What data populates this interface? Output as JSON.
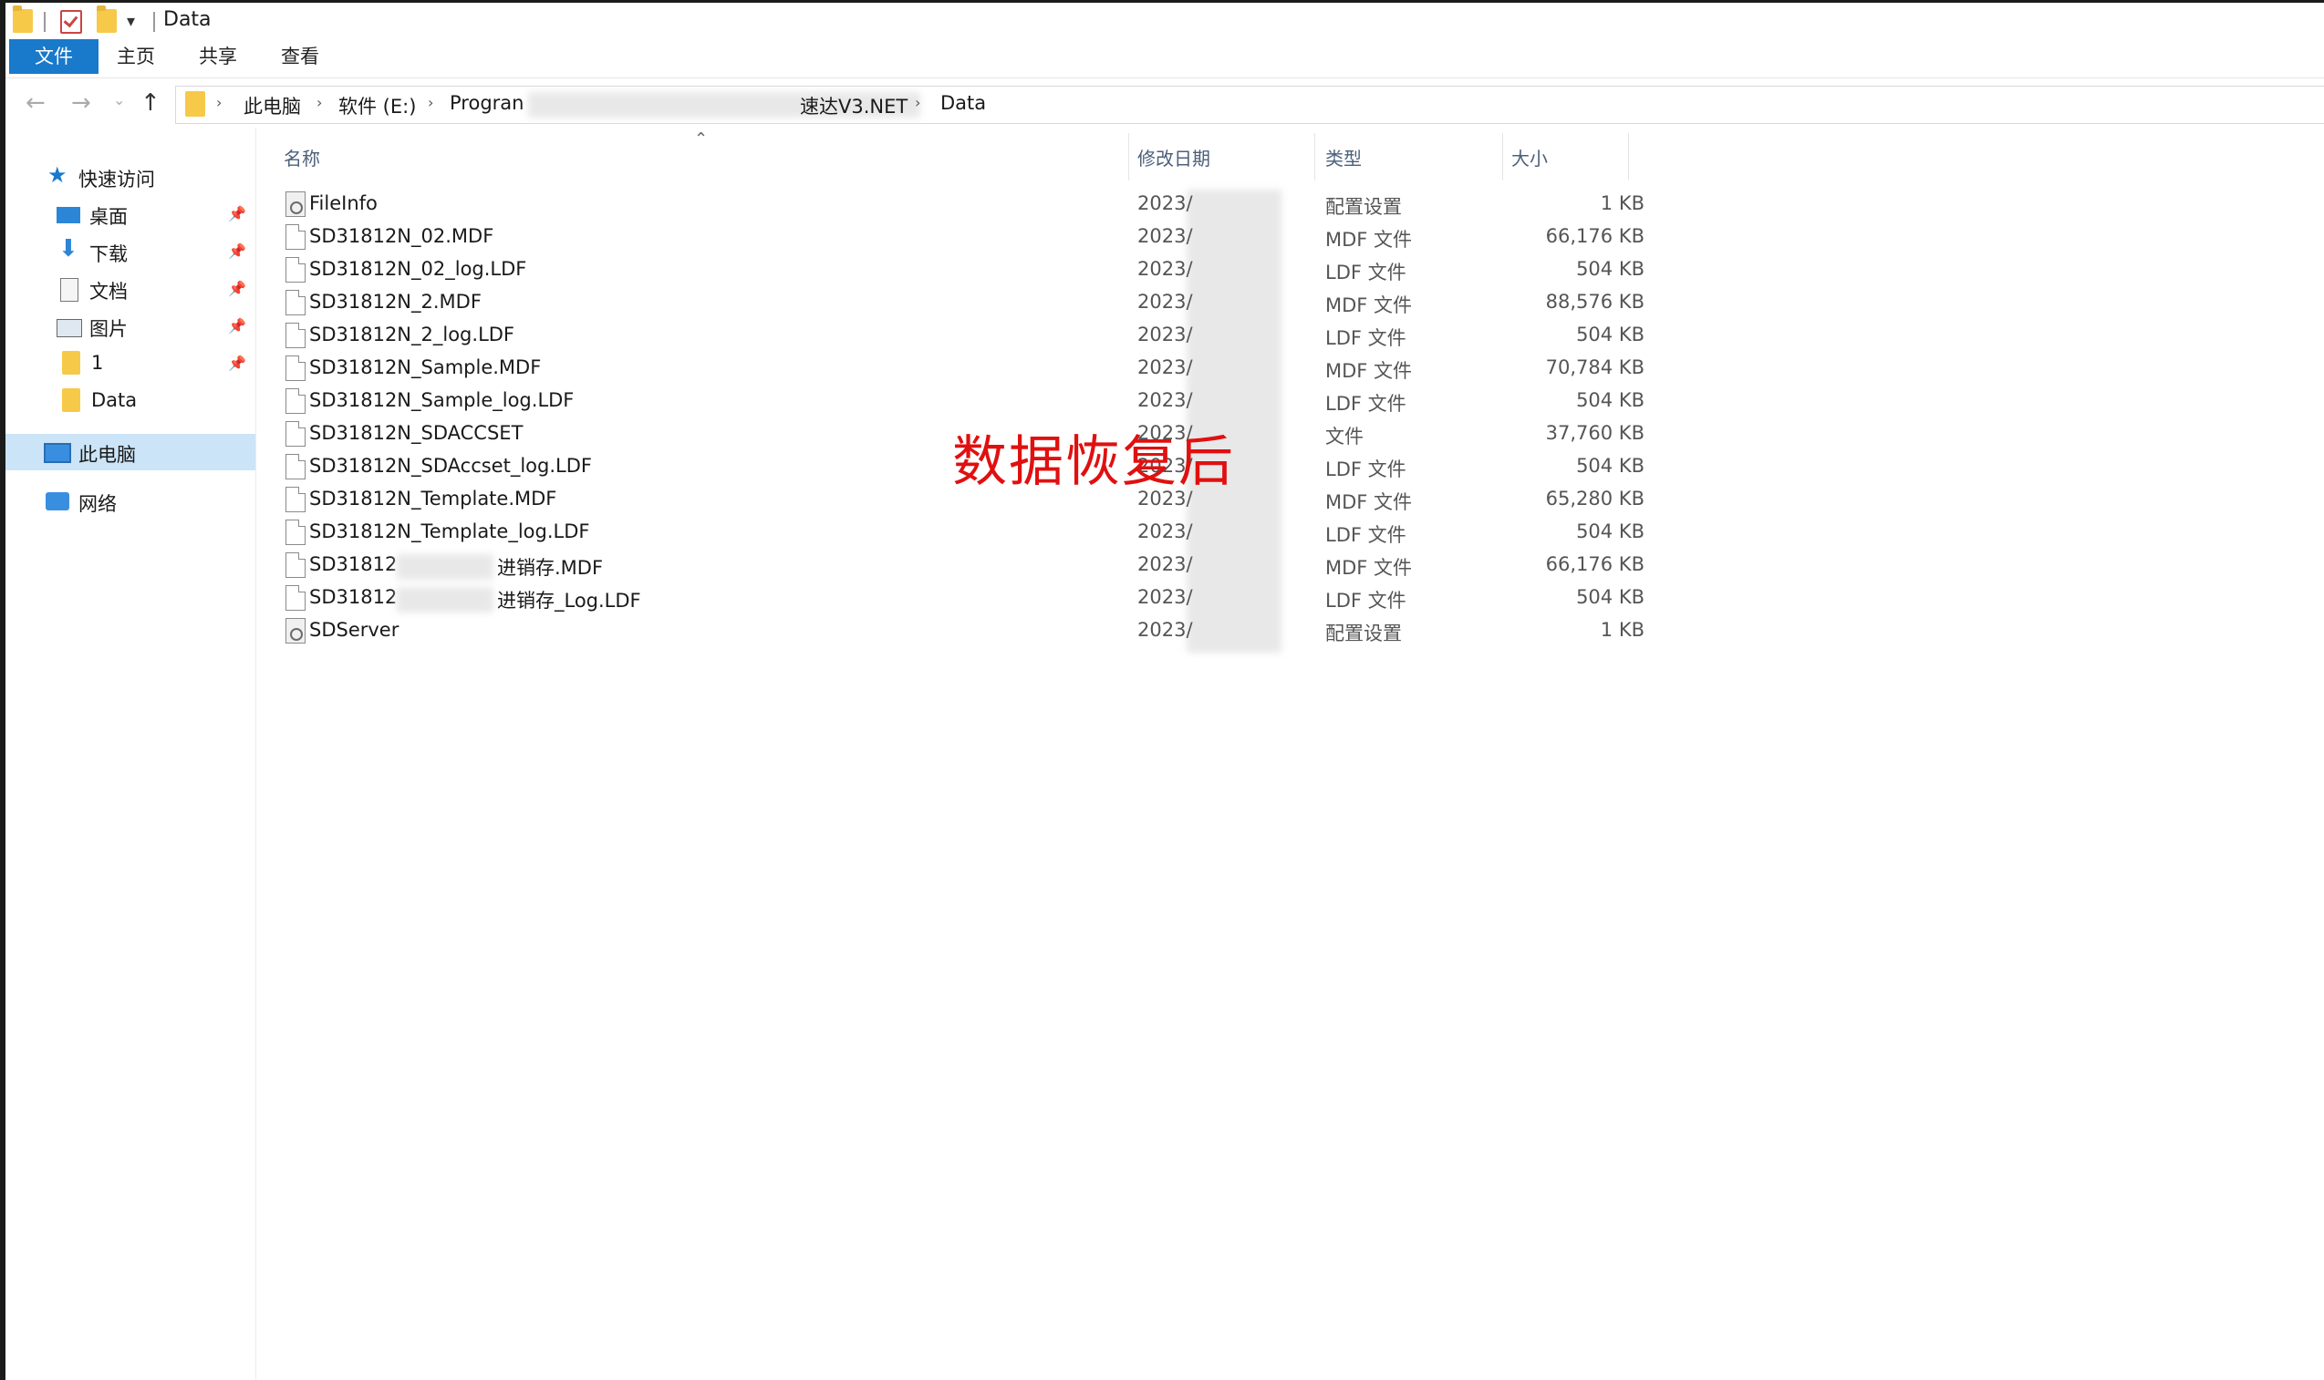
{
  "window": {
    "title": "Data"
  },
  "ribbon": {
    "tabs": [
      "文件",
      "主页",
      "共享",
      "查看"
    ]
  },
  "address": {
    "crumbs": [
      "此电脑",
      "软件 (E:)",
      "Progran",
      "速达V3.NET",
      "Data"
    ],
    "separator": "›"
  },
  "nav": {
    "items": [
      {
        "label": "快速访问",
        "icon": "star-icon"
      },
      {
        "label": "桌面",
        "icon": "desktop-icon",
        "pinned": true
      },
      {
        "label": "下载",
        "icon": "download-icon",
        "pinned": true
      },
      {
        "label": "文档",
        "icon": "document-icon",
        "pinned": true
      },
      {
        "label": "图片",
        "icon": "pictures-icon",
        "pinned": true
      },
      {
        "label": "1",
        "icon": "folder-icon",
        "pinned": true
      },
      {
        "label": "Data",
        "icon": "folder-icon"
      },
      {
        "label": "此电脑",
        "icon": "computer-icon",
        "selected": true
      },
      {
        "label": "网络",
        "icon": "network-icon"
      }
    ]
  },
  "columns": {
    "name": "名称",
    "date": "修改日期",
    "type": "类型",
    "size": "大小"
  },
  "files": [
    {
      "name": "FileInfo",
      "date": "2023/",
      "type": "配置设置",
      "size": "1 KB",
      "icon": "config-icon"
    },
    {
      "name": "SD31812N_02.MDF",
      "date": "2023/",
      "type": "MDF 文件",
      "size": "66,176 KB",
      "icon": "file-icon"
    },
    {
      "name": "SD31812N_02_log.LDF",
      "date": "2023/",
      "type": "LDF 文件",
      "size": "504 KB",
      "icon": "file-icon"
    },
    {
      "name": "SD31812N_2.MDF",
      "date": "2023/",
      "type": "MDF 文件",
      "size": "88,576 KB",
      "icon": "file-icon"
    },
    {
      "name": "SD31812N_2_log.LDF",
      "date": "2023/",
      "type": "LDF 文件",
      "size": "504 KB",
      "icon": "file-icon"
    },
    {
      "name": "SD31812N_Sample.MDF",
      "date": "2023/",
      "type": "MDF 文件",
      "size": "70,784 KB",
      "icon": "file-icon"
    },
    {
      "name": "SD31812N_Sample_log.LDF",
      "date": "2023/",
      "type": "LDF 文件",
      "size": "504 KB",
      "icon": "file-icon"
    },
    {
      "name": "SD31812N_SDACCSET",
      "date": "2023/",
      "type": "文件",
      "size": "37,760 KB",
      "icon": "file-icon"
    },
    {
      "name": "SD31812N_SDAccset_log.LDF",
      "date": "2023/",
      "type": "LDF 文件",
      "size": "504 KB",
      "icon": "file-icon"
    },
    {
      "name": "SD31812N_Template.MDF",
      "date": "2023/",
      "type": "MDF 文件",
      "size": "65,280 KB",
      "icon": "file-icon"
    },
    {
      "name": "SD31812N_Template_log.LDF",
      "date": "2023/",
      "type": "LDF 文件",
      "size": "504 KB",
      "icon": "file-icon"
    },
    {
      "name": "SD31812",
      "name_suffix": "进销存.MDF",
      "date": "2023/",
      "type": "MDF 文件",
      "size": "66,176 KB",
      "icon": "file-icon"
    },
    {
      "name": "SD31812",
      "name_suffix": "进销存_Log.LDF",
      "date": "2023/",
      "type": "LDF 文件",
      "size": "504 KB",
      "icon": "file-icon"
    },
    {
      "name": "SDServer",
      "date": "2023/",
      "type": "配置设置",
      "size": "1 KB",
      "icon": "config-icon"
    }
  ],
  "overlay": {
    "caption": "数据恢复后",
    "color": "#e01010"
  },
  "colors": {
    "accent": "#1979ca",
    "selected_bg": "#cce4f7",
    "folder": "#f7c948"
  }
}
